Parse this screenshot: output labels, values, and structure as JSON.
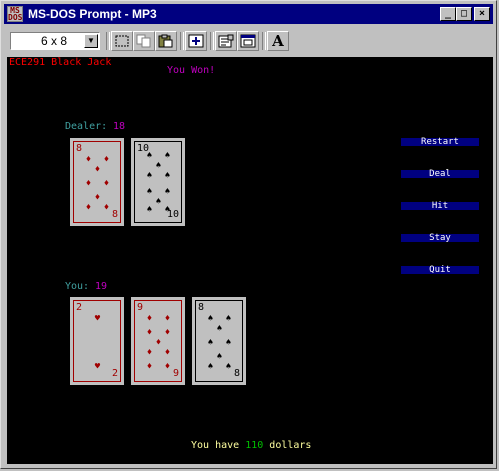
{
  "window": {
    "title": "MS-DOS Prompt - MP3",
    "minimize_label": "_",
    "maximize_label": "□",
    "close_label": "×"
  },
  "toolbar": {
    "font_size": "6 x 8",
    "font_dropdown_arrow": "▼",
    "tools": [
      "mark-icon",
      "copy-icon",
      "paste-icon",
      "fullscreen-icon",
      "properties-icon",
      "background-icon",
      "font-icon"
    ],
    "font_tool_label": "A"
  },
  "game": {
    "app_title": "ECE291 Black Jack",
    "status": "You Won!",
    "dealer_label": "Dealer:",
    "dealer_score": "18",
    "player_label": "You:",
    "player_score": "19",
    "money_prefix": "You have",
    "money": "110",
    "money_suffix": "dollars",
    "buttons": [
      "Restart",
      "Deal",
      "Hit",
      "Stay",
      "Quit"
    ],
    "dealer_cards": [
      {
        "rank": "8",
        "suit": "diamonds",
        "suit_glyph": "♦",
        "color": "#a00000"
      },
      {
        "rank": "10",
        "suit": "spades",
        "suit_glyph": "♠",
        "color": "#000000"
      }
    ],
    "player_cards": [
      {
        "rank": "2",
        "suit": "hearts",
        "suit_glyph": "♥",
        "color": "#a00000"
      },
      {
        "rank": "9",
        "suit": "diamonds",
        "suit_glyph": "♦",
        "color": "#a00000"
      },
      {
        "rank": "8",
        "suit": "spades",
        "suit_glyph": "♠",
        "color": "#000000"
      }
    ]
  },
  "colors": {
    "title_red": "#ff0000",
    "status_magenta": "#c000c0",
    "label_teal": "#40a0a0",
    "score_magenta": "#c000c0",
    "money_green": "#00c000",
    "text_yellow": "#ffffa0",
    "button_bg": "#000080"
  }
}
